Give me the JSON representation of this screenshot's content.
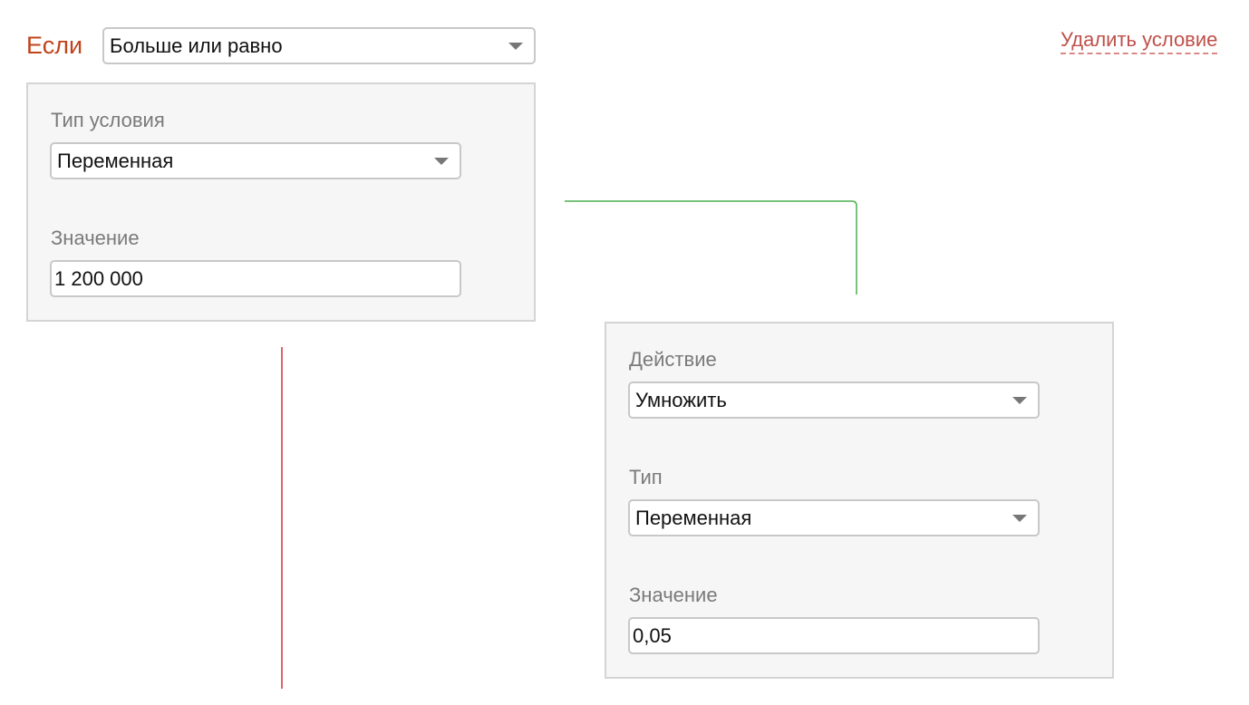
{
  "condition": {
    "if_label": "Если",
    "operator_value": "Больше или равно",
    "delete_label": "Удалить условие",
    "type_label": "Тип условия",
    "type_value": "Переменная",
    "value_label": "Значение",
    "value": "1 200 000"
  },
  "action": {
    "action_label": "Действие",
    "action_value": "Умножить",
    "type_label": "Тип",
    "type_value": "Переменная",
    "value_label": "Значение",
    "value": "0,05"
  },
  "icons": {
    "dropdown": "chevron-down-icon"
  },
  "colors": {
    "if_label": "#c0441a",
    "delete_link": "#c0504a",
    "true_branch_line": "#4caf50",
    "false_branch_line": "#d0303c",
    "panel_background": "#f6f6f6"
  }
}
